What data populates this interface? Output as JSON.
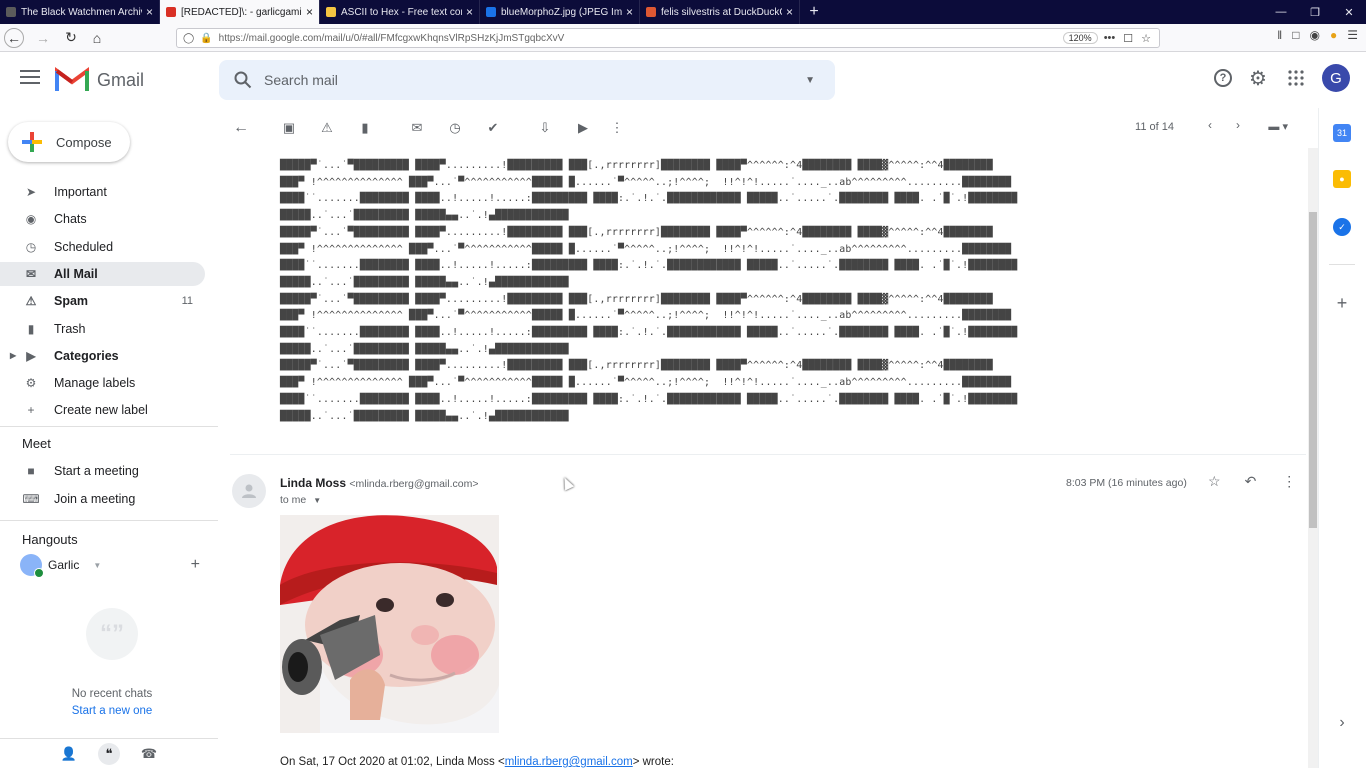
{
  "browser": {
    "tabs": [
      {
        "title": "The Black Watchmen Archive S",
        "active": false,
        "color": "#5b5b5b"
      },
      {
        "title": "[REDACTED]\\: - garlicgaming",
        "active": true,
        "color": "#d93025"
      },
      {
        "title": "ASCII to Hex - Free text conve",
        "active": false,
        "color": "#f4c542"
      },
      {
        "title": "blueMorphoZ.jpg (JPEG Image",
        "active": false,
        "color": "#1a73e8"
      },
      {
        "title": "felis silvestris at DuckDuckGo",
        "active": false,
        "color": "#de5833"
      }
    ],
    "url": "https://mail.google.com/mail/u/0/#all/FMfcgxwKhqnsVlRpSHzKjJmSTgqbcXvV",
    "zoom": "120%"
  },
  "gmail": {
    "logo_text": "Gmail",
    "search_placeholder": "Search mail",
    "avatar_letter": "G",
    "compose_label": "Compose",
    "nav": [
      {
        "label": "Important",
        "icon": "important-icon",
        "count": ""
      },
      {
        "label": "Chats",
        "icon": "chats-icon",
        "count": ""
      },
      {
        "label": "Scheduled",
        "icon": "scheduled-icon",
        "count": ""
      },
      {
        "label": "All Mail",
        "icon": "all-mail-icon",
        "count": "",
        "selected": true
      },
      {
        "label": "Spam",
        "icon": "spam-icon",
        "count": "11"
      },
      {
        "label": "Trash",
        "icon": "trash-icon",
        "count": ""
      },
      {
        "label": "Categories",
        "icon": "label-icon",
        "count": ""
      },
      {
        "label": "Manage labels",
        "icon": "gear-icon",
        "count": ""
      },
      {
        "label": "Create new label",
        "icon": "plus-icon",
        "count": ""
      }
    ],
    "meet_title": "Meet",
    "meet_items": [
      "Start a meeting",
      "Join a meeting"
    ],
    "hangouts_title": "Hangouts",
    "hangouts_user": "Garlic",
    "no_chats": "No recent chats",
    "start_new": "Start a new one",
    "pager": "11 of 14"
  },
  "message": {
    "ascii_lines": [
      "█████▀˙...˙▀█████████ ████▀.........!█████████ ███[.,rrrrrrrr]████████ ████▀^^^^^^:^4████████ ████▓^^^^^:^^4████████",
      "███▀ !^^^^^^^^^^^^^^ ███▀...˙▀^^^^^^^^^^^█████ █......˙▀^^^^^..;!^^^^;  !!^!^!.....˙...._..ab^^^^^^^^^.........████████",
      "████˙˙.......████████ ████..!.....!.....:█████████ ████:.˙.!.˙.████████████ █████..˙.....˙.████████ ████. .˙█˙.!████████",
      "█████..˙...˙█████████ █████▄▄..˙.!▄████████████",
      "█████▀˙...˙▀█████████ ████▀.........!█████████ ███[.,rrrrrrrr]████████ ████▀^^^^^^:^4████████ ████▓^^^^^:^^4████████",
      "███▀ !^^^^^^^^^^^^^^ ███▀...˙▀^^^^^^^^^^^█████ █......˙▀^^^^^..;!^^^^;  !!^!^!.....˙...._..ab^^^^^^^^^.........████████",
      "████˙˙.......████████ ████..!.....!.....:█████████ ████:.˙.!.˙.████████████ █████..˙.....˙.████████ ████. .˙█˙.!████████",
      "█████..˙...˙█████████ █████▄▄..˙.!▄████████████",
      "█████▀˙...˙▀█████████ ████▀.........!█████████ ███[.,rrrrrrrr]████████ ████▀^^^^^^:^4████████ ████▓^^^^^:^^4████████",
      "███▀ !^^^^^^^^^^^^^^ ███▀...˙▀^^^^^^^^^^^█████ █......˙▀^^^^^..;!^^^^;  !!^!^!.....˙...._..ab^^^^^^^^^.........████████",
      "████˙˙.......████████ ████..!.....!.....:█████████ ████:.˙.!.˙.████████████ █████..˙.....˙.████████ ████. .˙█˙.!████████",
      "█████..˙...˙█████████ █████▄▄..˙.!▄████████████",
      "█████▀˙...˙▀█████████ ████▀.........!█████████ ███[.,rrrrrrrr]████████ ████▀^^^^^^:^4████████ ████▓^^^^^:^^4████████",
      "███▀ !^^^^^^^^^^^^^^ ███▀...˙▀^^^^^^^^^^^█████ █......˙▀^^^^^..;!^^^^;  !!^!^!.....˙...._..ab^^^^^^^^^.........████████",
      "████˙˙.......████████ ████..!.....!.....:█████████ ████:.˙.!.˙.████████████ █████..˙.....˙.████████ ████. .˙█˙.!████████",
      "█████..˙...˙█████████ █████▄▄..˙.!▄████████████"
    ],
    "sender_name": "Linda Moss",
    "sender_email": "<mlinda.rberg@gmail.com>",
    "to": "to me",
    "time": "8:03 PM (16 minutes ago)",
    "quote_prefix": "On Sat, 17 Oct 2020 at 01:02, Linda Moss <",
    "quote_link": "mlinda.rberg@gmail.com",
    "quote_suffix": "> wrote:"
  },
  "colors": {
    "accent": "#1a73e8",
    "tabbar": "#0c0c3a",
    "selected_nav": "#e8eaed"
  }
}
